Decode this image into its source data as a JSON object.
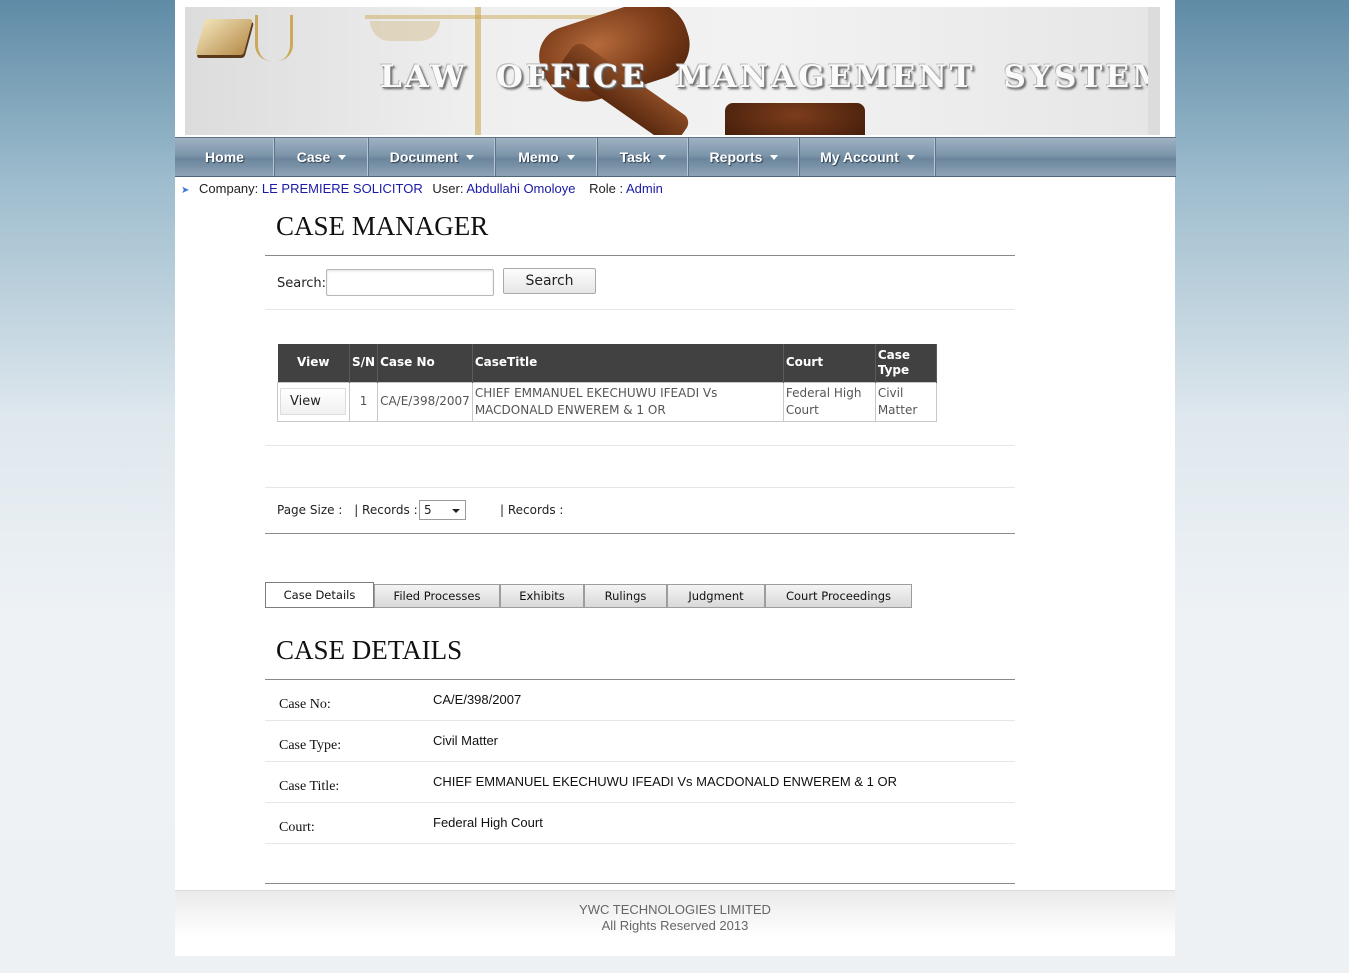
{
  "banner": {
    "title": "LAW OFFICE MANAGEMENT SYSTEM"
  },
  "nav": {
    "items": [
      {
        "label": "Home",
        "has_dropdown": false
      },
      {
        "label": "Case",
        "has_dropdown": true
      },
      {
        "label": "Document",
        "has_dropdown": true
      },
      {
        "label": "Memo",
        "has_dropdown": true
      },
      {
        "label": "Task",
        "has_dropdown": true
      },
      {
        "label": "Reports",
        "has_dropdown": true
      },
      {
        "label": "My Account",
        "has_dropdown": true
      }
    ]
  },
  "info": {
    "company_label": "Company:",
    "company": "LE PREMIERE SOLICITOR",
    "user_label": "User:",
    "user": "Abdullahi Omoloye",
    "role_label": "Role :",
    "role": "Admin"
  },
  "case_manager": {
    "title": "CASE MANAGER",
    "search_label": "Search:",
    "search_value": "",
    "search_button": "Search"
  },
  "grid": {
    "headers": [
      "View",
      "S/N",
      "Case No",
      "CaseTitle",
      "Court",
      "Case Type"
    ],
    "rows": [
      {
        "view": "View",
        "sn": "1",
        "case_no": "CA/E/398/2007",
        "case_title": "CHIEF EMMANUEL EKECHUWU IFEADI Vs MACDONALD ENWEREM & 1 OR",
        "court": "Federal High Court",
        "case_type": "Civil Matter"
      }
    ]
  },
  "pager": {
    "page_size_label": "Page Size :",
    "records_label": "| Records :",
    "page_size_value": "5",
    "records_label_2": "| Records :"
  },
  "tabs": [
    {
      "label": "Case Details",
      "active": true
    },
    {
      "label": "Filed Processes",
      "active": false
    },
    {
      "label": "Exhibits",
      "active": false
    },
    {
      "label": "Rulings",
      "active": false
    },
    {
      "label": "Judgment",
      "active": false
    },
    {
      "label": "Court Proceedings",
      "active": false
    }
  ],
  "case_details": {
    "title": "CASE DETAILS",
    "case_no_label": "Case No:",
    "case_no": "CA/E/398/2007",
    "case_type_label": "Case Type:",
    "case_type": "Civil Matter",
    "case_title_label": "Case Title:",
    "case_title": "CHIEF EMMANUEL EKECHUWU IFEADI Vs MACDONALD ENWEREM & 1 OR",
    "court_label": "Court:",
    "court": "Federal High Court"
  },
  "footer": {
    "line1": "YWC TECHNOLOGIES LIMITED",
    "line2": "All Rights Reserved 2013"
  },
  "colors": {
    "nav_bg": "#7d95aa",
    "table_header_bg": "#414141",
    "link_blue": "#1a1aa6"
  }
}
